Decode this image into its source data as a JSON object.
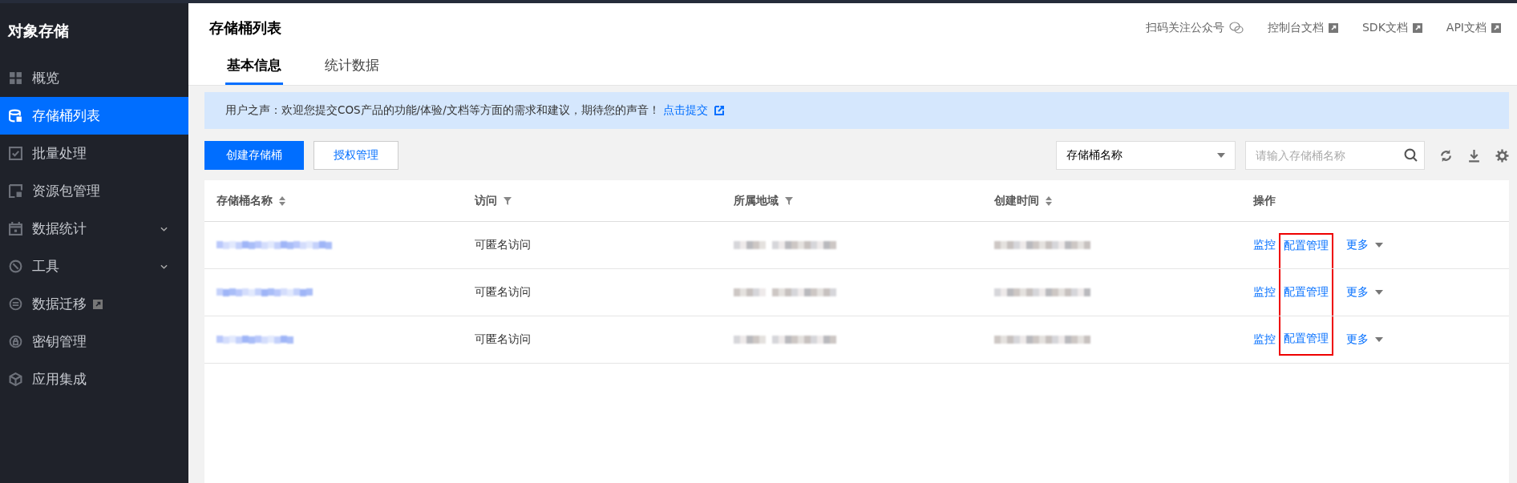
{
  "sidebar": {
    "title": "对象存储",
    "items": [
      {
        "label": "概览",
        "selected": false,
        "expandable": false,
        "external": false
      },
      {
        "label": "存储桶列表",
        "selected": true,
        "expandable": false,
        "external": false
      },
      {
        "label": "批量处理",
        "selected": false,
        "expandable": false,
        "external": false
      },
      {
        "label": "资源包管理",
        "selected": false,
        "expandable": false,
        "external": false
      },
      {
        "label": "数据统计",
        "selected": false,
        "expandable": true,
        "external": false
      },
      {
        "label": "工具",
        "selected": false,
        "expandable": true,
        "external": false
      },
      {
        "label": "数据迁移",
        "selected": false,
        "expandable": false,
        "external": true
      },
      {
        "label": "密钥管理",
        "selected": false,
        "expandable": false,
        "external": false
      },
      {
        "label": "应用集成",
        "selected": false,
        "expandable": false,
        "external": false
      }
    ]
  },
  "header": {
    "title": "存储桶列表",
    "links": [
      {
        "label": "扫码关注公众号",
        "kind": "wechat"
      },
      {
        "label": "控制台文档",
        "kind": "external"
      },
      {
        "label": "SDK文档",
        "kind": "external"
      },
      {
        "label": "API文档",
        "kind": "external"
      }
    ],
    "tabs": [
      {
        "label": "基本信息",
        "selected": true
      },
      {
        "label": "统计数据",
        "selected": false
      }
    ]
  },
  "banner": {
    "text": "用户之声：欢迎您提交COS产品的功能/体验/文档等方面的需求和建议，期待您的声音！",
    "link": "点击提交"
  },
  "toolbar": {
    "buttons": [
      {
        "label": "创建存储桶",
        "kind": "primary"
      },
      {
        "label": "授权管理",
        "kind": "default"
      }
    ],
    "select": "存储桶名称",
    "search_placeholder": "请输入存储桶名称"
  },
  "table": {
    "columns": [
      {
        "label": "存储桶名称",
        "sortable": true,
        "filterable": false
      },
      {
        "label": "访问",
        "sortable": false,
        "filterable": true
      },
      {
        "label": "所属地域",
        "sortable": false,
        "filterable": true
      },
      {
        "label": "创建时间",
        "sortable": true,
        "filterable": false
      },
      {
        "label": "操作",
        "sortable": false,
        "filterable": false
      }
    ],
    "rows": [
      {
        "access": "可匿名访问",
        "actions": [
          {
            "label": "监控",
            "highlighted": false
          },
          {
            "label": "配置管理",
            "highlighted": true
          },
          {
            "label": "更多",
            "highlighted": false
          }
        ]
      },
      {
        "access": "可匿名访问",
        "actions": [
          {
            "label": "监控",
            "highlighted": false
          },
          {
            "label": "配置管理",
            "highlighted": true
          },
          {
            "label": "更多",
            "highlighted": false
          }
        ]
      },
      {
        "access": "可匿名访问",
        "actions": [
          {
            "label": "监控",
            "highlighted": false
          },
          {
            "label": "配置管理",
            "highlighted": true
          },
          {
            "label": "更多",
            "highlighted": false
          }
        ]
      }
    ]
  }
}
